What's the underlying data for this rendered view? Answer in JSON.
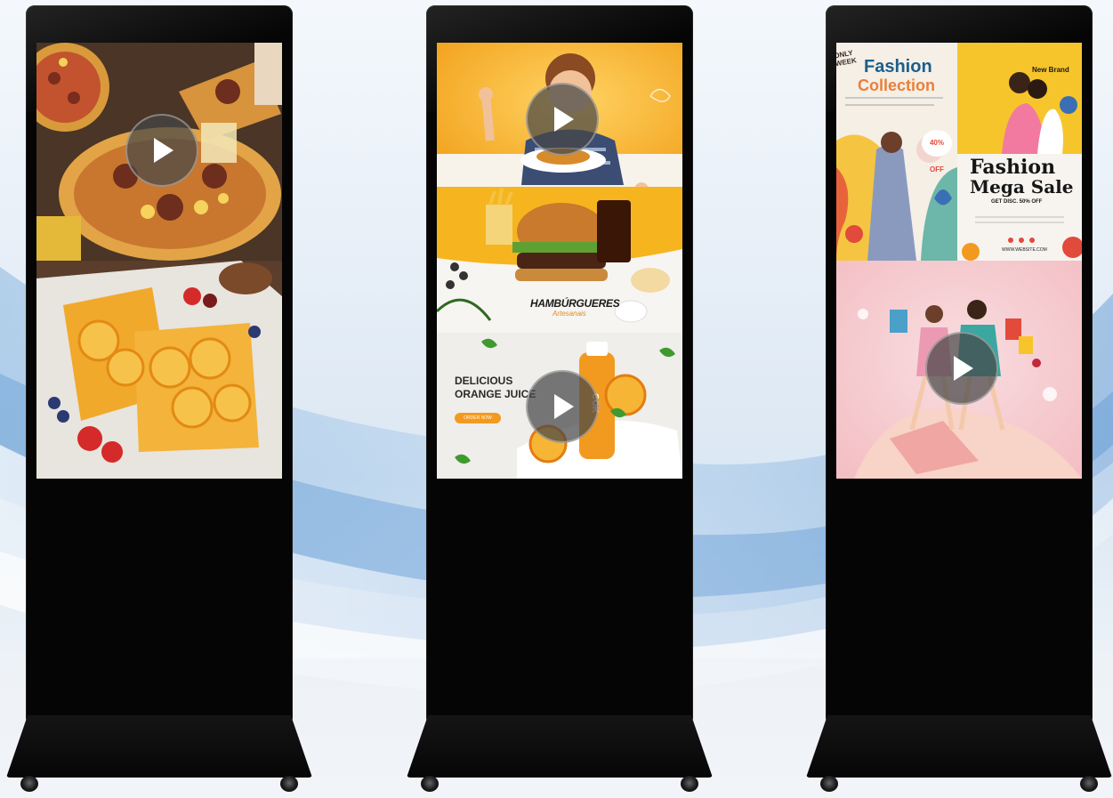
{
  "kiosks": [
    {
      "name": "Food kiosk",
      "panels": [
        "Pizza",
        "Orange toast"
      ],
      "play_icon": "play-icon"
    },
    {
      "name": "Restaurant kiosk",
      "burger_brand": "HAMBÚRGUERES",
      "burger_sub": "Artesanais",
      "juice_title_1": "DELICIOUS",
      "juice_title_2": "ORANGE JUICE",
      "juice_button": "ORDER NOW",
      "bottle_label": "COK",
      "play_icon": "play-icon"
    },
    {
      "name": "Fashion kiosk",
      "collection_title_1": "Fashion",
      "collection_title_2": "Collection",
      "only_week": "ONLY WEEK",
      "discount_text": "40% OFF",
      "new_brand": "New Brand",
      "sale_title_1": "Fashion",
      "sale_title_2": "Mega Sale",
      "sale_sub": "GET DISC. 50% OFF",
      "website": "WWW.WEBSITE.COM",
      "play_icon": "play-icon"
    }
  ],
  "colors": {
    "kiosk_body": "#050505",
    "food_orange": "#f3a51d",
    "juice_bg": "#f2f1ee",
    "fashion_pink": "#f6c7cf",
    "fashion_yellow": "#f7c52a"
  }
}
